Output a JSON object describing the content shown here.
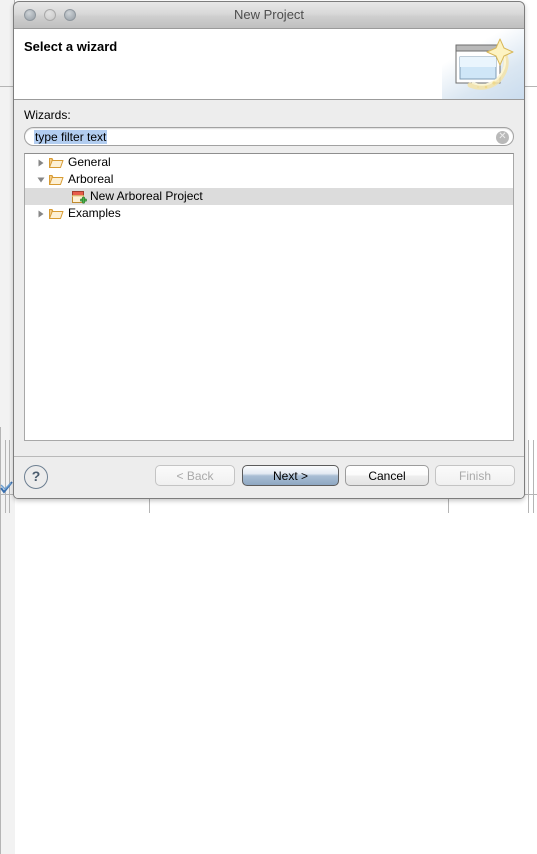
{
  "window": {
    "title": "New Project",
    "traffic_lights": [
      "close-button",
      "minimize-button",
      "zoom-button"
    ]
  },
  "header": {
    "title": "Select a wizard",
    "art_icon": "wizard-sparkle-icon"
  },
  "main": {
    "wizards_label": "Wizards:",
    "filter": {
      "value": "type filter text",
      "placeholder": "type filter text",
      "clear_glyph": "✕",
      "selected": true
    },
    "tree": [
      {
        "label": "General",
        "level": 1,
        "expanded": false,
        "icon": "folder-icon",
        "twisty": "▶",
        "selected": false
      },
      {
        "label": "Arboreal",
        "level": 1,
        "expanded": true,
        "icon": "folder-icon",
        "twisty": "▼",
        "selected": false
      },
      {
        "label": "New Arboreal Project",
        "level": 2,
        "expanded": null,
        "icon": "new-project-icon",
        "twisty": "",
        "selected": true
      },
      {
        "label": "Examples",
        "level": 1,
        "expanded": false,
        "icon": "folder-icon",
        "twisty": "▶",
        "selected": false
      }
    ]
  },
  "footer": {
    "help_label": "?",
    "buttons": [
      {
        "label": "< Back",
        "state": "disabled"
      },
      {
        "label": "Next >",
        "state": "default"
      },
      {
        "label": "Cancel",
        "state": "enabled"
      },
      {
        "label": "Finish",
        "state": "disabled"
      }
    ]
  },
  "colors": {
    "selection": "#dcdcdc",
    "text_selection": "#b2cdf0",
    "default_button": "#8ea7c2",
    "folder": "#f0b95a",
    "dialog_bg": "#ededed"
  }
}
